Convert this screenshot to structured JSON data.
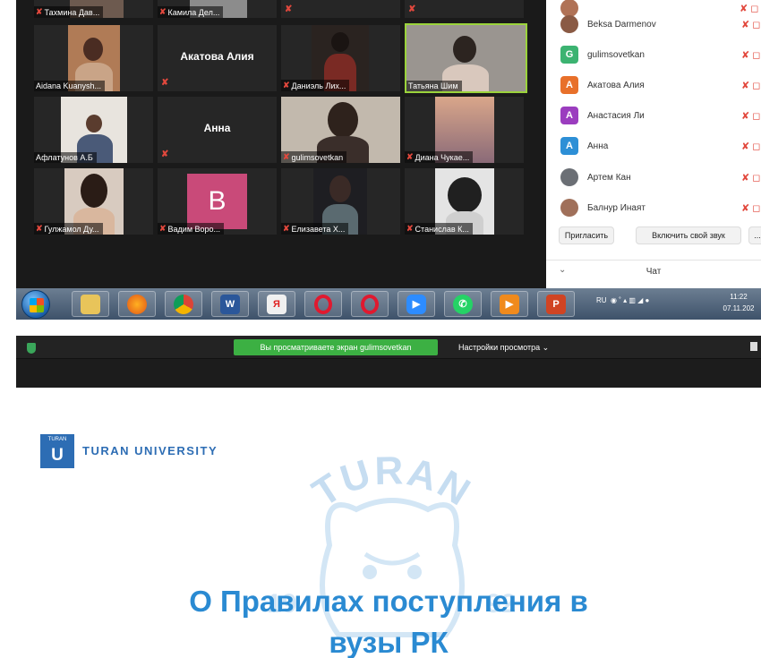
{
  "gallery": {
    "tiles": [
      {
        "name": "Тахмина Дав..."
      },
      {
        "name": "Камила Дел..."
      },
      {
        "name": ""
      },
      {
        "name": ""
      },
      {
        "name": "Aidana Kuanysh..."
      },
      {
        "name": "Акатова Алия"
      },
      {
        "name": "Даниэль Лих..."
      },
      {
        "name": "Татьяна Шим"
      },
      {
        "name": "Афлатунов А.Б"
      },
      {
        "name": "Анна"
      },
      {
        "name": "gulimsovetkan"
      },
      {
        "name": "Диана Чукае..."
      },
      {
        "name": "Гулжамол Ду..."
      },
      {
        "name": "Вадим Воро..."
      },
      {
        "name": "Елизавета Х..."
      },
      {
        "name": "Станислав К..."
      }
    ],
    "badge_letter": "B"
  },
  "participants": {
    "items": [
      {
        "name": "Beksa Darmenov",
        "avatar": "",
        "color": "#8a5a44"
      },
      {
        "name": "gulimsovetkan",
        "avatar": "G",
        "color": "#3cb371"
      },
      {
        "name": "Акатова Алия",
        "avatar": "A",
        "color": "#e8702a"
      },
      {
        "name": "Анастасия Ли",
        "avatar": "A",
        "color": "#9b3dbf"
      },
      {
        "name": "Анна",
        "avatar": "A",
        "color": "#2d8fd6"
      },
      {
        "name": "Артем Кан",
        "avatar": "",
        "color": "#6b6f75"
      },
      {
        "name": "Балнур Инаят",
        "avatar": "",
        "color": "#a0705a"
      }
    ],
    "invite_label": "Пригласить",
    "unmute_label": "Включить свой звук",
    "more_label": "...",
    "chat_label": "Чат"
  },
  "taskbar": {
    "lang": "RU",
    "time": "11:22",
    "date": "07.11.202"
  },
  "share": {
    "viewing_label": "Вы просматриваете экран gulimsovetkan",
    "view_options_label": "Настройки просмотра"
  },
  "slide": {
    "logo_small": "TURAN",
    "logo_letter": "U",
    "university_name": "TURAN UNIVERSITY",
    "watermark_word": "TURAN",
    "watermark_year_left": "19",
    "watermark_year_right": "92",
    "title_line1": "О Правилах поступления в",
    "title_line2": "вузы РК"
  },
  "colors": {
    "accent_blue": "#2a8ad2",
    "brand_blue": "#2d6db4",
    "share_green": "#3cb043",
    "active_tile_border": "#9bd33b",
    "mute_red": "#e2483d"
  }
}
